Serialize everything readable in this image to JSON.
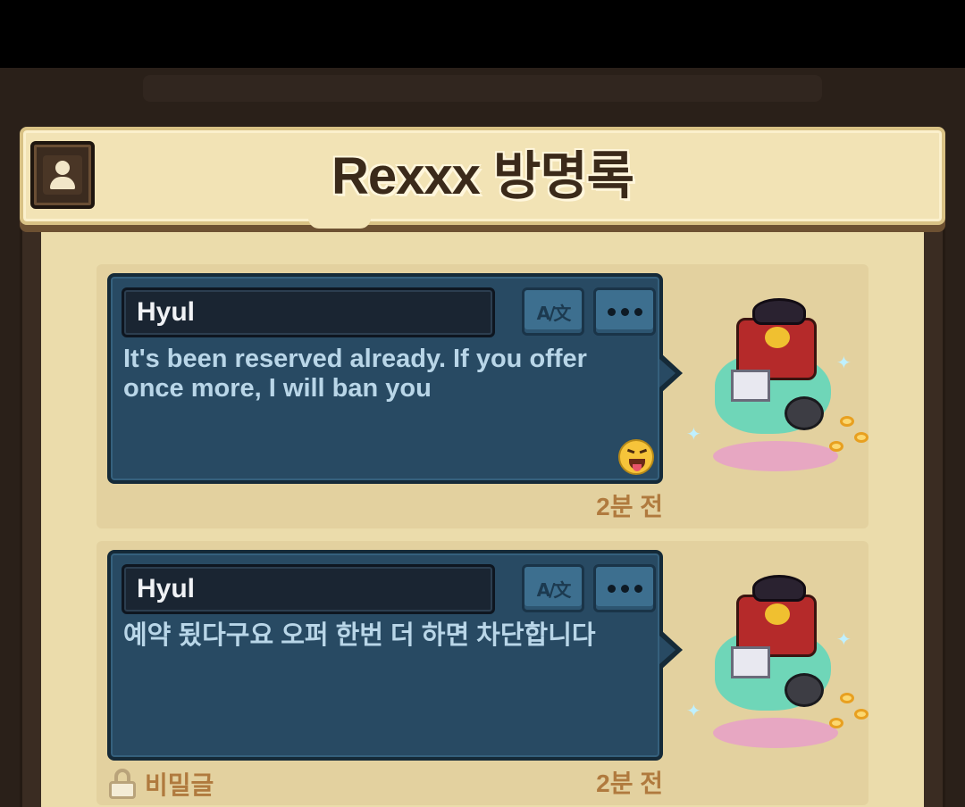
{
  "header": {
    "title": "Rexxx 방명록",
    "profile_icon": "user-profile-icon"
  },
  "entries": [
    {
      "author": "Hyul",
      "message": "It's been reserved already. If you offer once more, I will ban you",
      "translate_icon": "translate-icon",
      "more_icon": "more-options-icon",
      "emoji": "tongue-out-emoji",
      "time": "2분 전",
      "secret": false
    },
    {
      "author": "Hyul",
      "message": "예약 됬다구요 오퍼 한번 더 하면 차단합니다",
      "translate_icon": "translate-icon",
      "more_icon": "more-options-icon",
      "time": "2분 전",
      "secret": true,
      "secret_label": "비밀글",
      "lock_icon": "lock-icon"
    }
  ],
  "colors": {
    "bubble": "#284a63",
    "panel": "#ebdcab",
    "timestamp": "#b07a3e",
    "message_text": "#b9d6e8"
  }
}
